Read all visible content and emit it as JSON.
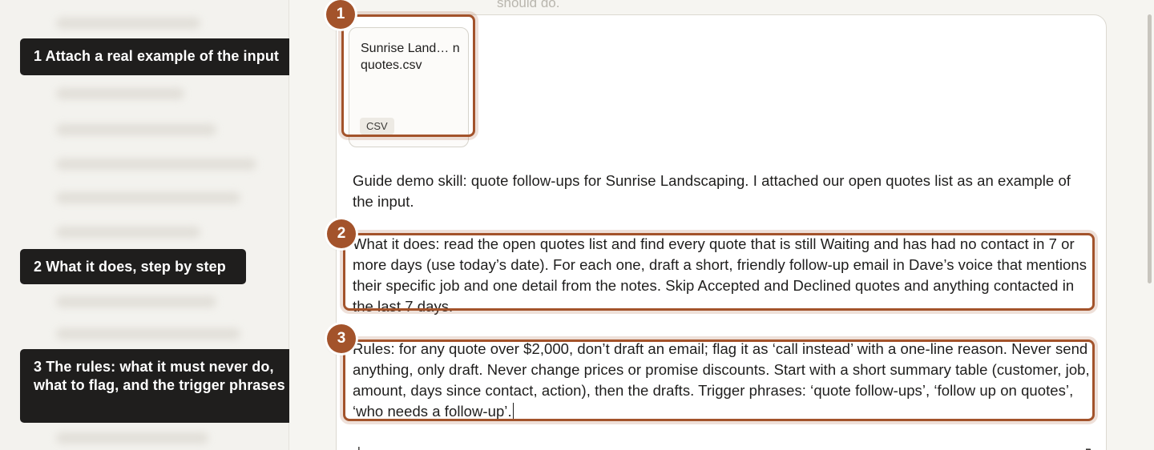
{
  "callouts": [
    {
      "number": "1",
      "text": "1 Attach a real example of the input"
    },
    {
      "number": "2",
      "text": "2 What it does, step by step"
    },
    {
      "number": "3",
      "text": "3 The rules: what it must never do, what to flag, and the trigger phrases"
    }
  ],
  "background_text": "should do.",
  "attachment": {
    "name": "Sunrise Land… n quotes.csv",
    "type_badge": "CSV"
  },
  "prompt": {
    "intro": "Guide demo skill: quote follow-ups for Sunrise Landscaping. I attached our open quotes list as an example of the input.",
    "what_it_does": "What it does: read the open quotes list and find every quote that is still Waiting and has had no contact in 7 or more days (use today’s date). For each one, draft a short, friendly follow-up email in Dave’s voice that mentions their specific job and one detail from the notes. Skip Accepted and Declined quotes and anything contacted in the last 7 days.",
    "rules": "Rules: for any quote over $2,000, don’t draft an email; flag it as ‘call instead’ with a one-line reason. Never send anything, only draft. Never change prices or promise discounts. Start with a short summary table (customer, job, amount, days since contact, action), then the drafts. Trigger phrases: ‘quote follow-ups’, ‘follow up on quotes’, ‘who needs a follow-up’."
  },
  "composer": {
    "add_icon": "plus-icon",
    "send_icon": "arrow-icon"
  },
  "colors": {
    "accent": "#a3532b",
    "callout_bg": "#1f1e1d",
    "text": "#1f1e1d"
  }
}
